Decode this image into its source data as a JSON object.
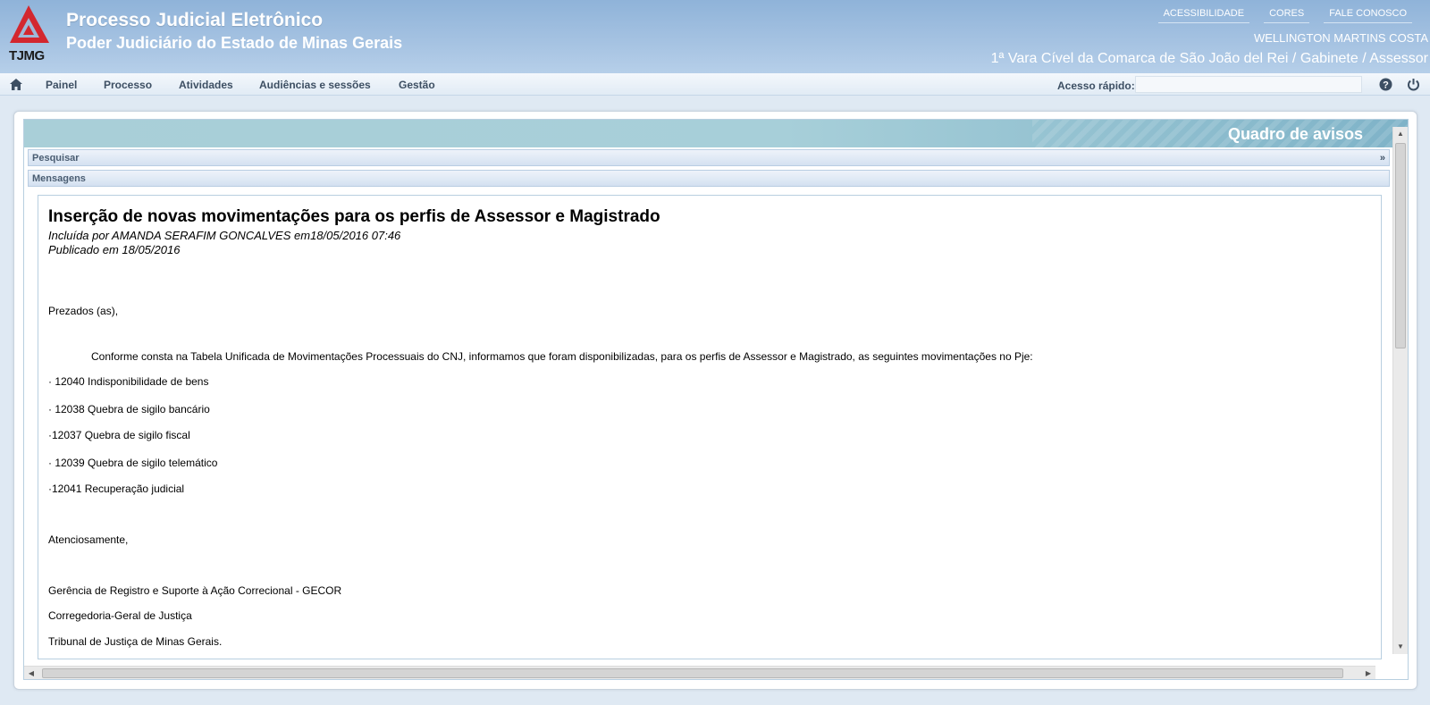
{
  "header": {
    "logo_text": "TJMG",
    "title": "Processo Judicial Eletrônico",
    "subtitle": "Poder Judiciário do Estado de Minas Gerais",
    "top_links": [
      "ACESSIBILIDADE",
      "CORES",
      "FALE CONOSCO"
    ],
    "user_name": "WELLINGTON MARTINS COSTA",
    "user_location": "1ª Vara Cível da Comarca de São João del Rei / Gabinete / Assessor"
  },
  "menu": {
    "items": [
      "Painel",
      "Processo",
      "Atividades",
      "Audiências e sessões",
      "Gestão"
    ],
    "quick_access_label": "Acesso rápido:",
    "quick_access_value": ""
  },
  "panel": {
    "banner_title": "Quadro de avisos",
    "search_label": "Pesquisar",
    "search_toggle": "»",
    "messages_label": "Mensagens"
  },
  "message": {
    "title": "Inserção de novas movimentações para os perfis de Assessor e Magistrado",
    "included_by": "Incluída por AMANDA SERAFIM GONCALVES em18/05/2016 07:46",
    "published": "Publicado em 18/05/2016",
    "greeting": "Prezados (as),",
    "intro": "Conforme consta na Tabela Unificada de Movimentações Processuais do CNJ, informamos que foram disponibilizadas, para os perfis de Assessor e Magistrado, as seguintes movimentações no Pje:",
    "items": [
      "· 12040 Indisponibilidade de bens",
      "· 12038 Quebra de sigilo bancário",
      "·12037 Quebra de sigilo fiscal",
      "· 12039 Quebra de sigilo telemático",
      "·12041 Recuperação judicial"
    ],
    "closing": "Atenciosamente,",
    "signature": [
      "Gerência de Registro e Suporte à Ação Correcional - GECOR",
      "Corregedoria-Geral de Justiça",
      "Tribunal de Justiça de Minas Gerais."
    ]
  },
  "colors": {
    "header_bg": "#a6c3e2",
    "logo_red": "#d3272f",
    "menu_text": "#3d4f63",
    "banner_bg": "#a7cfd9"
  }
}
